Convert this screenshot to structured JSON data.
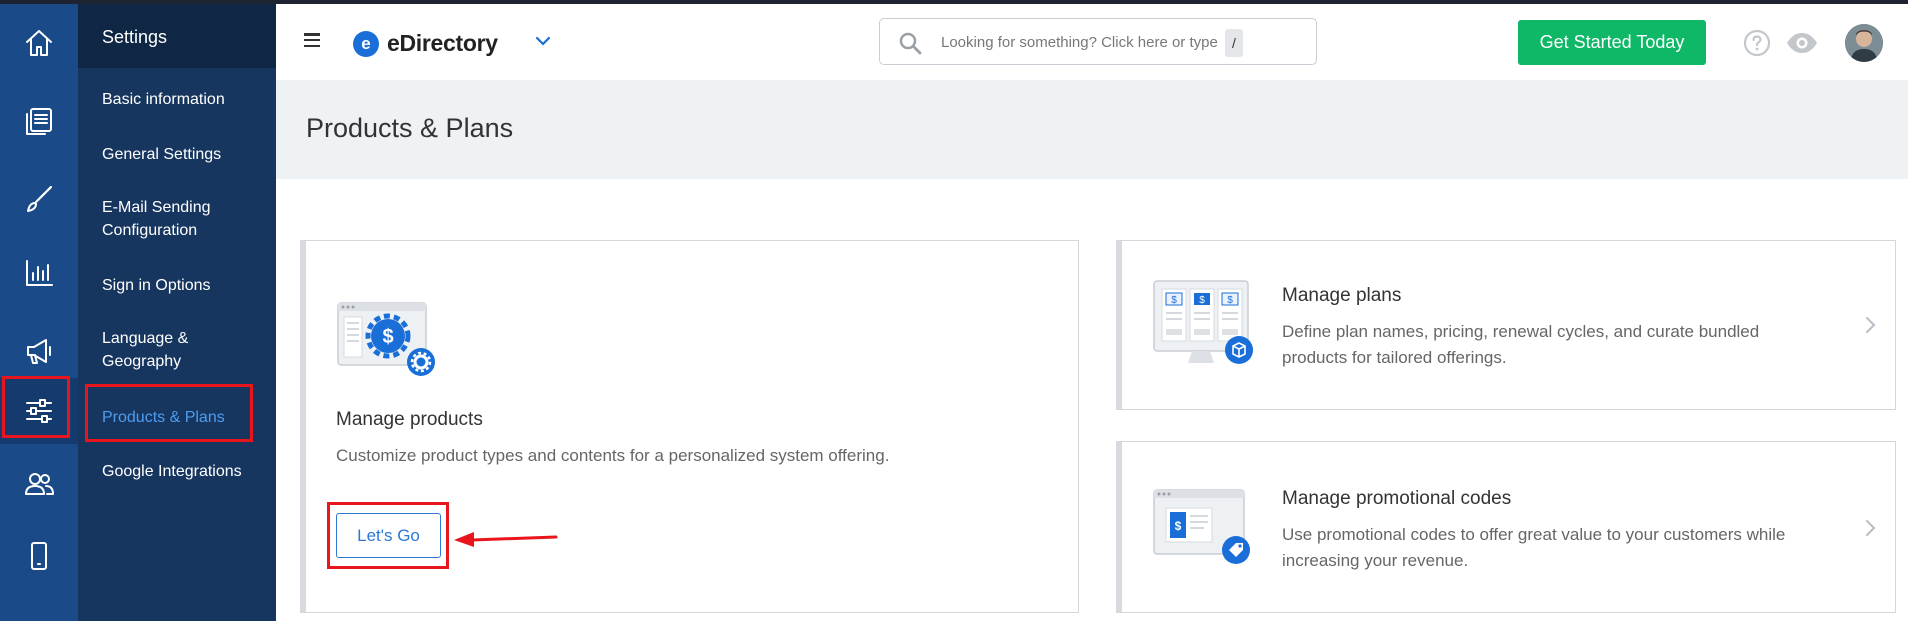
{
  "app": {
    "name": "eDirectory",
    "logo_letter": "e"
  },
  "submenu": {
    "title": "Settings",
    "items": [
      {
        "label": "Basic information"
      },
      {
        "label": "General Settings"
      },
      {
        "label": "E-Mail Sending Configuration"
      },
      {
        "label": "Sign in Options"
      },
      {
        "label": "Language & Geography"
      },
      {
        "label": "Products & Plans",
        "active": true
      },
      {
        "label": "Google Integrations"
      }
    ]
  },
  "rail": {
    "icons": [
      "home-icon",
      "content-icon",
      "brush-icon",
      "reports-icon",
      "megaphone-icon",
      "settings-sliders-icon",
      "users-icon",
      "mobile-icon"
    ],
    "active": "settings-sliders-icon"
  },
  "header": {
    "search": {
      "placeholder": "Looking for something? Click here or type",
      "shortcut": "/"
    },
    "cta_label": "Get Started Today"
  },
  "page": {
    "title": "Products & Plans"
  },
  "cards": {
    "products": {
      "heading": "Manage products",
      "description": "Customize product types and contents for a personalized system offering.",
      "button_label": "Let's Go"
    },
    "plans": {
      "heading": "Manage plans",
      "description": "Define plan names, pricing, renewal cycles, and curate bundled products for tailored offerings."
    },
    "promo": {
      "heading": "Manage promotional codes",
      "description": "Use promotional codes to offer great value to your customers while increasing your revenue."
    }
  },
  "colors": {
    "rail_bg": "#1b4a88",
    "submenu_bg": "#17365f",
    "accent_blue": "#1a6ed8",
    "cta_green": "#0fb866",
    "annotation_red": "#e8151c"
  }
}
